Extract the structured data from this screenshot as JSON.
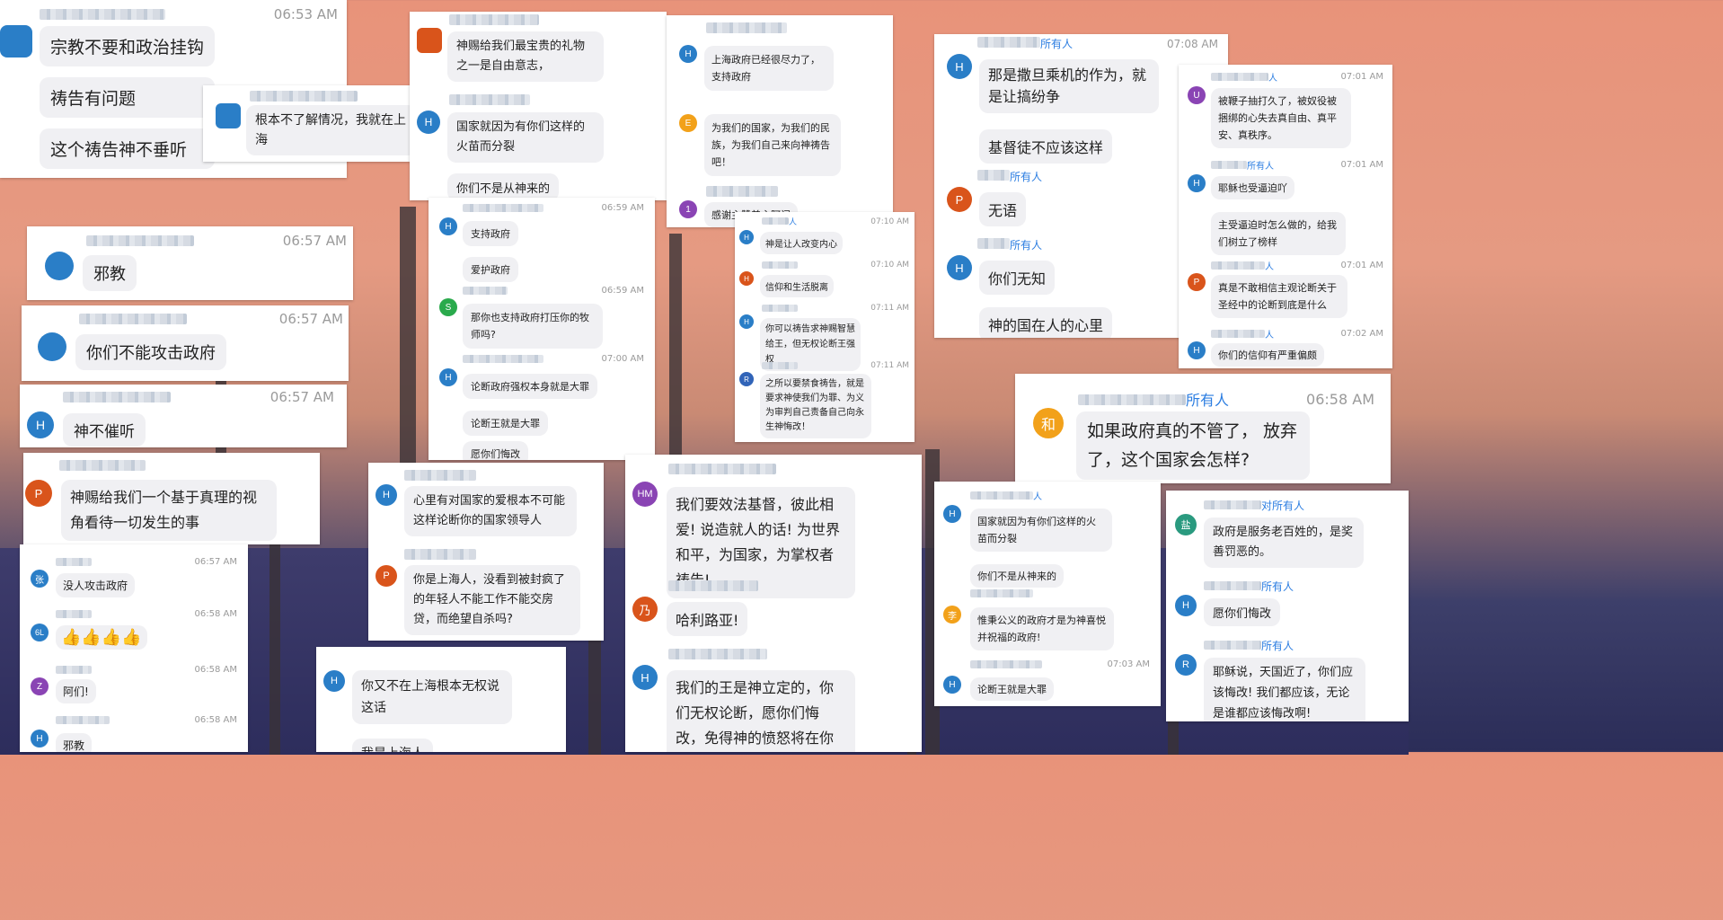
{
  "colors": {
    "accent_blue": "#2a7ec7",
    "to_link": "#2b7de1",
    "bubble": "#f0f0f3"
  },
  "cards": {
    "c1": {
      "time": "06:53 AM",
      "avatar": "",
      "bubbles": [
        "宗教不要和政治挂钩",
        "祷告有问题",
        "这个祷告神不垂听"
      ]
    },
    "c2": {
      "avatar": "",
      "bubbles": [
        "根本不了解情况，我就在上海"
      ]
    },
    "c3": {
      "m1": {
        "avatar": "",
        "bubble": "神赐给我们最宝贵的礼物之一是自由意志，"
      },
      "m2": {
        "avatar": "H",
        "bubbles": [
          "国家就因为有你们这样的火苗而分裂",
          "你们不是从神来的"
        ]
      }
    },
    "c4": {
      "m1": {
        "avatar": "H",
        "bubble": "上海政府已经很尽力了，支持政府"
      },
      "m2": {
        "avatar": "E",
        "bubble": "为我们的国家，为我们的民族，为我们自己来向神祷告吧！"
      },
      "m3": {
        "avatar": "1",
        "bubble": "感谢主赞美主阿门"
      }
    },
    "c5": {
      "m1": {
        "to": "所有人",
        "time": "07:08 AM",
        "avatar": "H",
        "bubbles": [
          "那是撒旦乘机的作为，就是让搞纷争",
          "基督徒不应该这样"
        ]
      },
      "m2": {
        "to": "所有人",
        "time": "07",
        "avatar": "P",
        "bubble": "无语"
      },
      "m3": {
        "to": "所有人",
        "time": "07",
        "avatar": "H",
        "bubbles": [
          "你们无知",
          "神的国在人的心里"
        ]
      }
    },
    "c6": {
      "m1": {
        "to": "人",
        "time": "07:01 AM",
        "avatar": "U",
        "bubble": "被鞭子抽打久了，被奴役被捆绑的心失去真自由、真平安、真秩序。"
      },
      "m2": {
        "to": "所有人",
        "time": "07:01 AM",
        "avatar": "H",
        "bubbles": [
          "耶稣也受逼迫吖",
          "主受逼迫时怎么做的，给我们树立了榜样"
        ]
      },
      "m3": {
        "to": "人",
        "time": "07:01 AM",
        "avatar": "P",
        "bubble": "真是不敢相信主观论断关于圣经中的论断到底是什么"
      },
      "m4": {
        "to": "人",
        "time": "07:02 AM",
        "avatar": "H",
        "bubble": "你们的信仰有严重偏颇"
      }
    },
    "c7": {
      "time": "06:57 AM",
      "avatar": "",
      "bubble": "邪教"
    },
    "c8": {
      "time": "06:57 AM",
      "avatar": "",
      "bubble": "你们不能攻击政府"
    },
    "c9": {
      "time": "06:57 AM",
      "avatar": "H",
      "bubble": "神不催听"
    },
    "c10": {
      "avatar": "P",
      "bubble": "神赐给我们一个基于真理的视角看待一切发生的事"
    },
    "c11": {
      "m1": {
        "time": "06:59 AM",
        "avatar": "H",
        "bubbles": [
          "支持政府",
          "爱护政府"
        ]
      },
      "m2": {
        "time": "06:59 AM",
        "avatar": "S",
        "bubble": "那你也支持政府打压你的牧师吗?"
      },
      "m3": {
        "time": "07:00 AM",
        "avatar": "H",
        "bubbles": [
          "论断政府强权本身就是大罪",
          "论断王就是大罪",
          "愿你们悔改"
        ]
      }
    },
    "c12": {
      "m1": {
        "to": "人",
        "time": "07:10 AM",
        "avatar": "H",
        "bubble": "神是让人改变内心"
      },
      "m2": {
        "time": "07:10 AM",
        "avatar": "H",
        "bubble": "信仰和生活脱离"
      },
      "m3": {
        "time": "07:11 AM",
        "avatar": "H",
        "bubble": "你可以祷告求神赐智慧给王，但无权论断王强权"
      },
      "m4": {
        "time": "07:11 AM",
        "avatar": "R",
        "bubble": "之所以要禁食祷告，就是要求神使我们为罪、为义为审判自己责备自己向永生神悔改！"
      }
    },
    "c13": {
      "to": "所有人",
      "time": "06:58 AM",
      "avatar": "和",
      "bubble": "如果政府真的不管了， 放弃了，这个国家会怎样?"
    },
    "c14": {
      "m1": {
        "time": "06:57 AM",
        "avatar": "张",
        "bubble": "没人攻击政府"
      },
      "m2": {
        "time": "06:58 AM",
        "avatar": "6L",
        "bubble": "👍👍👍👍"
      },
      "m3": {
        "time": "06:58 AM",
        "avatar": "Z",
        "bubble": "阿们!"
      },
      "m4": {
        "time": "06:58 AM",
        "avatar": "H",
        "bubble": "邪教"
      }
    },
    "c15": {
      "m1": {
        "avatar": "H",
        "bubble": "心里有对国家的爱根本不可能这样论断你的国家领导人"
      },
      "m2": {
        "avatar": "P",
        "bubble": "你是上海人，没看到被封疯了的年轻人不能工作不能交房贷，而绝望自杀吗?"
      }
    },
    "c16": {
      "avatar": "H",
      "bubbles": [
        "你又不在上海根本无权说这话",
        "我是上海人"
      ]
    },
    "c17": {
      "m1": {
        "avatar": "HM",
        "bubble": "我们要效法基督，彼此相爱! 说造就人的话! 为世界和平，为国家，为掌权者祷告!"
      },
      "m2": {
        "avatar": "乃",
        "bubble": "哈利路亚!"
      },
      "m3": {
        "avatar": "H",
        "bubble": "我们的王是神立定的，你们无权论断，愿你们悔改，免得神的愤怒将在你们身上"
      }
    },
    "c18": {
      "m1": {
        "to": "人",
        "avatar": "H",
        "bubbles": [
          "国家就因为有你们这样的火苗而分裂",
          "你们不是从神来的"
        ]
      },
      "m2": {
        "avatar": "李",
        "bubble": "惟秉公义的政府才是为神喜悦并祝福的政府!"
      },
      "m3": {
        "time": "07:03 AM",
        "avatar": "H",
        "bubble": "论断王就是大罪"
      }
    },
    "c19": {
      "m1": {
        "to": "对所有人",
        "avatar": "盐",
        "bubble": "政府是服务老百姓的，是奖善罚恶的。"
      },
      "m2": {
        "to": "所有人",
        "avatar": "H",
        "bubble": "愿你们悔改"
      },
      "m3": {
        "to": "所有人",
        "avatar": "R",
        "bubble": "耶稣说，天国近了，你们应该悔改! 我们都应该，无论是谁都应该悔改啊!"
      }
    }
  }
}
